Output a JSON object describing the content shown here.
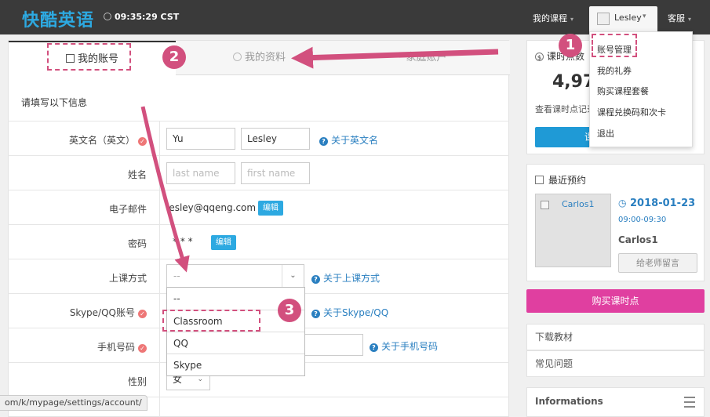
{
  "header": {
    "logo": "快酷英语",
    "clock": "09:35:29 CST",
    "my_courses": "我的课程",
    "user_name": "Lesley",
    "customer_service": "客服"
  },
  "user_menu": {
    "items": [
      "账号管理",
      "我的礼券",
      "购买课程套餐",
      "课程兑换码和次卡",
      "退出"
    ]
  },
  "tabs": [
    {
      "label": "我的账号",
      "active": true
    },
    {
      "label": "我的资料",
      "active": false
    },
    {
      "label": "家庭账户",
      "active": false
    }
  ],
  "form": {
    "section_title": "请填写以下信息",
    "english_name": {
      "label": "英文名（英文）",
      "first": "Yu",
      "last": "Lesley",
      "help": "关于英文名"
    },
    "name": {
      "label": "姓名",
      "last_placeholder": "last name",
      "first_placeholder": "first name"
    },
    "email": {
      "label": "电子邮件",
      "value": "lesley@qqeng.com",
      "edit": "编辑"
    },
    "password": {
      "label": "密码",
      "value": "* * *",
      "edit": "编辑"
    },
    "class_method": {
      "label": "上课方式",
      "value": "--",
      "help": "关于上课方式",
      "options": [
        "--",
        "Classroom",
        "QQ",
        "Skype"
      ]
    },
    "skype_qq": {
      "label": "Skype/QQ账号",
      "help": "关于Skype/QQ"
    },
    "phone": {
      "label": "手机号码",
      "help": "关于手机号码"
    },
    "gender": {
      "label": "性别",
      "value": "女"
    }
  },
  "sidebar": {
    "lesson_points": {
      "title": "课时点数",
      "value": "4,97",
      "sub": "查看课时点记录",
      "button": "课时"
    },
    "recent": {
      "title": "最近预约",
      "teacher_img_alt": "Carlos1",
      "date": "2018-01-23",
      "time": "09:00-09:30",
      "teacher": "Carlos1",
      "message_button": "给老师留言"
    },
    "buy_button": "购买课时点",
    "links": [
      "下载教材",
      "常见问题"
    ],
    "informations": "Informations"
  },
  "status_url": "om/k/mypage/settings/account/",
  "annotations": {
    "badges": [
      "1",
      "2",
      "3"
    ]
  },
  "colors": {
    "accent": "#2da9e1",
    "annotation": "#d2507e",
    "buy": "#e03fa0"
  }
}
